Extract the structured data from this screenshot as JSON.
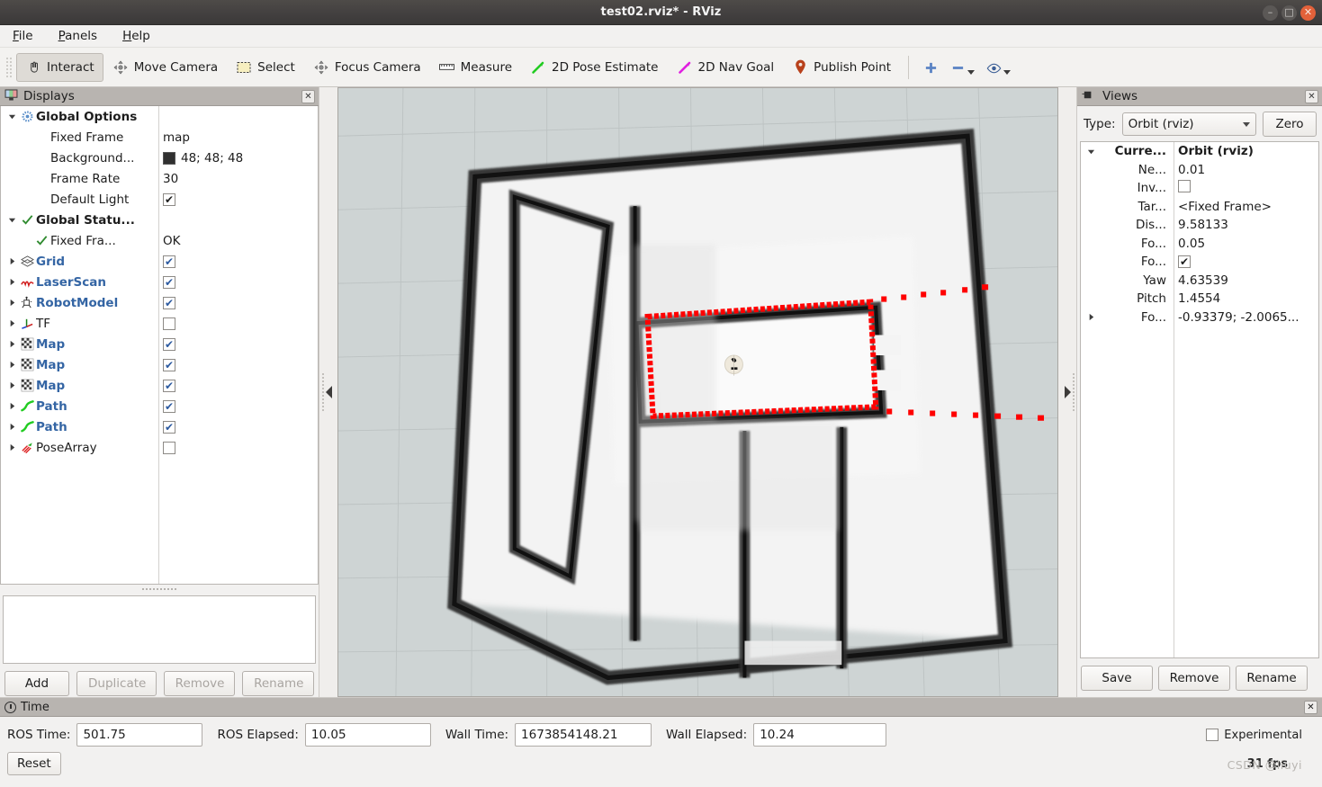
{
  "window": {
    "title": "test02.rviz* - RViz",
    "controls": {
      "minimize": "–",
      "maximize": "□",
      "close": "✕"
    }
  },
  "menubar": {
    "items": [
      {
        "label": "File",
        "mnemonic": "F"
      },
      {
        "label": "Panels",
        "mnemonic": "P"
      },
      {
        "label": "Help",
        "mnemonic": "H"
      }
    ]
  },
  "toolbar": {
    "items": [
      {
        "label": "Interact",
        "icon": "hand-cursor-icon",
        "active": true
      },
      {
        "label": "Move Camera",
        "icon": "move-camera-icon",
        "active": false
      },
      {
        "label": "Select",
        "icon": "select-rect-icon",
        "active": false
      },
      {
        "label": "Focus Camera",
        "icon": "focus-camera-icon",
        "active": false
      },
      {
        "label": "Measure",
        "icon": "ruler-icon",
        "active": false
      },
      {
        "label": "2D Pose Estimate",
        "icon": "green-arrow-icon",
        "active": false
      },
      {
        "label": "2D Nav Goal",
        "icon": "magenta-arrow-icon",
        "active": false
      },
      {
        "label": "Publish Point",
        "icon": "map-pin-icon",
        "active": false
      }
    ],
    "zoom_controls": [
      {
        "icon": "plus-icon",
        "label": ""
      },
      {
        "icon": "minus-icon",
        "label": ""
      },
      {
        "icon": "eye-icon",
        "label": ""
      }
    ]
  },
  "displays": {
    "panel_title": "Displays",
    "close_label": "✕",
    "tree": [
      {
        "indent": 0,
        "expander": "down",
        "icon": "gear-icon",
        "label": "Global Options",
        "style": "bold",
        "value_type": "none"
      },
      {
        "indent": 1,
        "expander": "none",
        "icon": "none",
        "label": "Fixed Frame",
        "style": "plain",
        "value_type": "text",
        "value": "map"
      },
      {
        "indent": 1,
        "expander": "none",
        "icon": "none",
        "label": "Background...",
        "style": "plain",
        "value_type": "swatch",
        "value": "48; 48; 48",
        "color": "#303030"
      },
      {
        "indent": 1,
        "expander": "none",
        "icon": "none",
        "label": "Frame Rate",
        "style": "plain",
        "value_type": "text",
        "value": "30"
      },
      {
        "indent": 1,
        "expander": "none",
        "icon": "none",
        "label": "Default Light",
        "style": "plain",
        "value_type": "checkbox-dark",
        "checked": true
      },
      {
        "indent": 0,
        "expander": "down",
        "icon": "green-check-icon",
        "label": "Global Statu...",
        "style": "bold",
        "value_type": "none"
      },
      {
        "indent": 1,
        "expander": "none",
        "icon": "green-check-icon",
        "label": "Fixed Fra...",
        "style": "plain",
        "value_type": "text",
        "value": "OK"
      },
      {
        "indent": 0,
        "expander": "right",
        "icon": "grid-icon",
        "label": "Grid",
        "style": "blue",
        "value_type": "checkbox",
        "checked": true
      },
      {
        "indent": 0,
        "expander": "right",
        "icon": "laserscan-icon",
        "label": "LaserScan",
        "style": "blue",
        "value_type": "checkbox",
        "checked": true
      },
      {
        "indent": 0,
        "expander": "right",
        "icon": "robotmodel-icon",
        "label": "RobotModel",
        "style": "blue",
        "value_type": "checkbox",
        "checked": true
      },
      {
        "indent": 0,
        "expander": "right",
        "icon": "tf-icon",
        "label": "TF",
        "style": "plain",
        "value_type": "checkbox",
        "checked": false
      },
      {
        "indent": 0,
        "expander": "right",
        "icon": "map-icon",
        "label": "Map",
        "style": "blue",
        "value_type": "checkbox",
        "checked": true
      },
      {
        "indent": 0,
        "expander": "right",
        "icon": "map-icon",
        "label": "Map",
        "style": "blue",
        "value_type": "checkbox",
        "checked": true
      },
      {
        "indent": 0,
        "expander": "right",
        "icon": "map-icon",
        "label": "Map",
        "style": "blue",
        "value_type": "checkbox",
        "checked": true
      },
      {
        "indent": 0,
        "expander": "right",
        "icon": "path-icon",
        "label": "Path",
        "style": "blue",
        "value_type": "checkbox",
        "checked": true
      },
      {
        "indent": 0,
        "expander": "right",
        "icon": "path-icon",
        "label": "Path",
        "style": "blue",
        "value_type": "checkbox",
        "checked": true
      },
      {
        "indent": 0,
        "expander": "right",
        "icon": "posearray-icon",
        "label": "PoseArray",
        "style": "plain",
        "value_type": "checkbox",
        "checked": false
      }
    ],
    "buttons": [
      {
        "label": "Add",
        "enabled": true
      },
      {
        "label": "Duplicate",
        "enabled": false
      },
      {
        "label": "Remove",
        "enabled": false
      },
      {
        "label": "Rename",
        "enabled": false
      }
    ]
  },
  "views": {
    "panel_title": "Views",
    "close_label": "✕",
    "type_label": "Type:",
    "type_value": "Orbit (rviz)",
    "zero_button": "Zero",
    "tree": [
      {
        "expander": "down",
        "label": "Curre...",
        "value": "Orbit (rviz)",
        "bold": true,
        "value_type": "text"
      },
      {
        "expander": "none",
        "label": "Ne...",
        "value": "0.01",
        "bold": false,
        "value_type": "text"
      },
      {
        "expander": "none",
        "label": "Inv...",
        "value": "",
        "bold": false,
        "value_type": "checkbox",
        "checked": false
      },
      {
        "expander": "none",
        "label": "Tar...",
        "value": "<Fixed Frame>",
        "bold": false,
        "value_type": "text"
      },
      {
        "expander": "none",
        "label": "Dis...",
        "value": "9.58133",
        "bold": false,
        "value_type": "text"
      },
      {
        "expander": "none",
        "label": "Fo...",
        "value": "0.05",
        "bold": false,
        "value_type": "text"
      },
      {
        "expander": "none",
        "label": "Fo...",
        "value": "",
        "bold": false,
        "value_type": "checkbox",
        "checked": true
      },
      {
        "expander": "none",
        "label": "Yaw",
        "value": "4.63539",
        "bold": false,
        "value_type": "text"
      },
      {
        "expander": "none",
        "label": "Pitch",
        "value": "1.4554",
        "bold": false,
        "value_type": "text"
      },
      {
        "expander": "right",
        "label": "Fo...",
        "value": "-0.93379; -2.0065...",
        "bold": false,
        "value_type": "text"
      }
    ],
    "buttons": [
      {
        "label": "Save"
      },
      {
        "label": "Remove"
      },
      {
        "label": "Rename"
      }
    ]
  },
  "time": {
    "panel_title": "Time",
    "close_label": "✕",
    "fields": [
      {
        "label": "ROS Time:",
        "value": "501.75"
      },
      {
        "label": "ROS Elapsed:",
        "value": "10.05"
      },
      {
        "label": "Wall Time:",
        "value": "1673854148.21"
      },
      {
        "label": "Wall Elapsed:",
        "value": "10.24"
      }
    ],
    "experimental_label": "Experimental",
    "experimental_checked": false,
    "reset_button": "Reset",
    "fps": "31 fps",
    "watermark": "CSDN @liuyi"
  },
  "viewport": {
    "background_color": "#ced4d4",
    "grid_color": "#b9bfbf",
    "laserscan_color": "#ff0000",
    "robot_marker_color": "#efe9dc"
  }
}
